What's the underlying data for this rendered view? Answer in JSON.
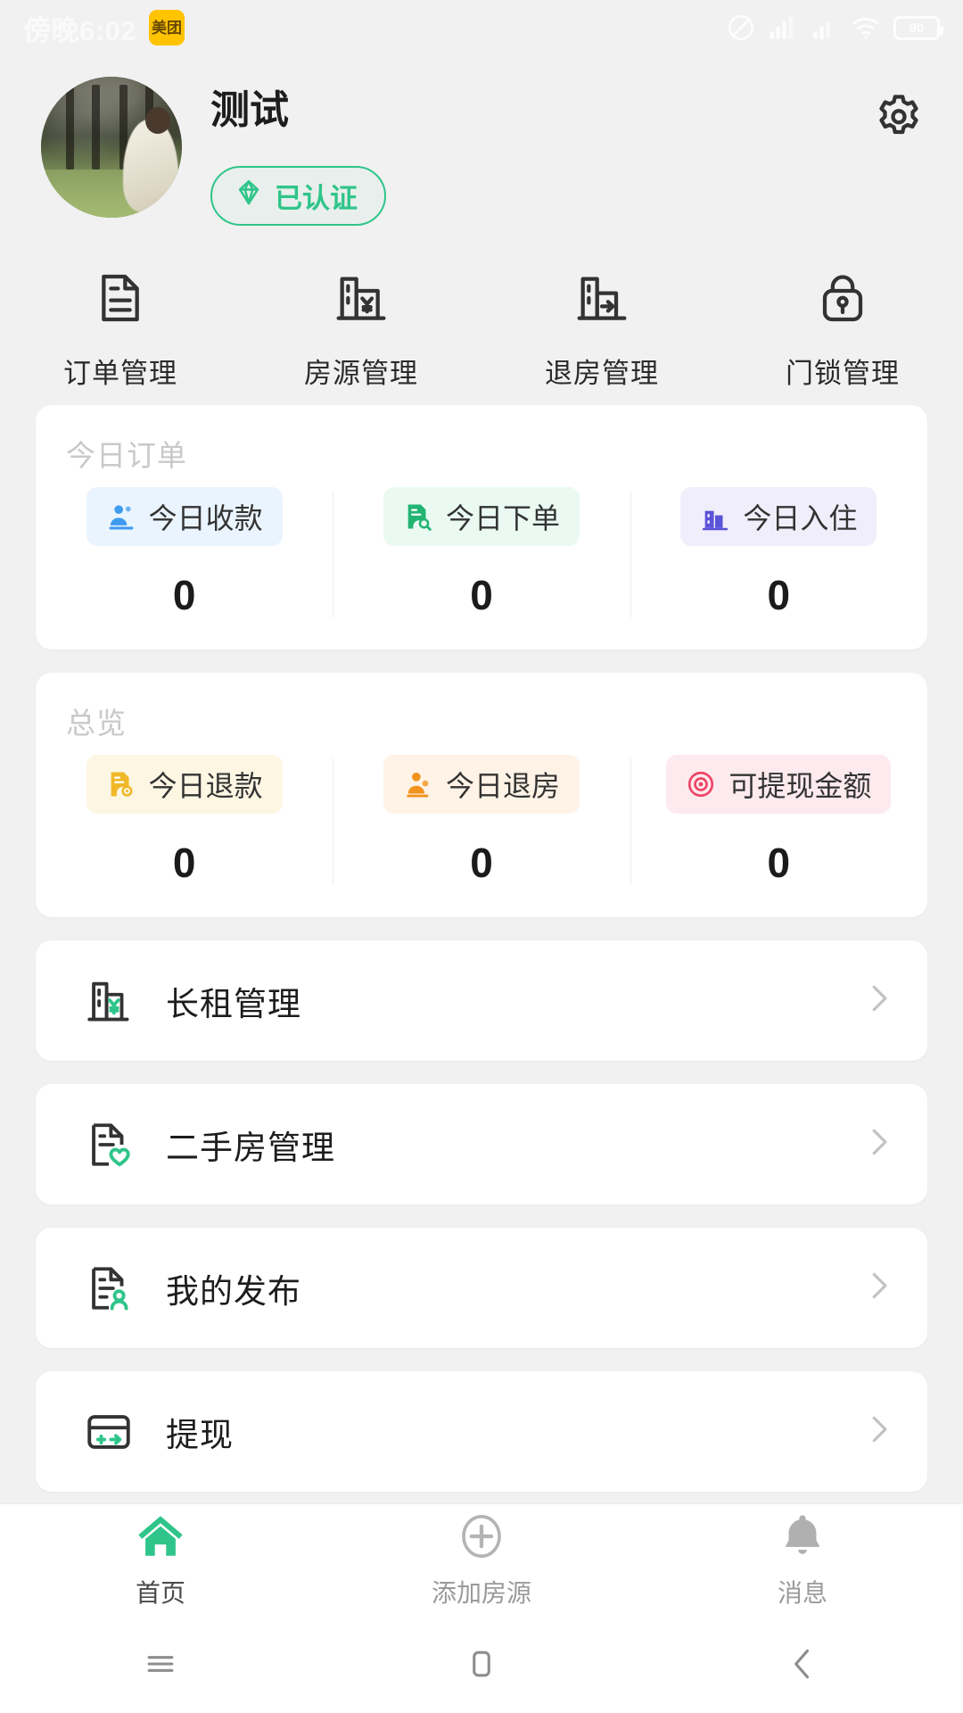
{
  "statusbar": {
    "time": "傍晚6:02",
    "app_badge": "美团",
    "battery_level": "90",
    "icons": [
      "mute-icon",
      "signal-icon",
      "signal-2-icon",
      "wifi-icon",
      "battery-icon"
    ]
  },
  "profile": {
    "name": "测试",
    "verified_label": "已认证",
    "verified_color": "#2FC58A",
    "settings_icon": "gear-icon",
    "avatar_alt": "user-avatar"
  },
  "quicknav": [
    {
      "label": "订单管理",
      "icon": "document-order-icon"
    },
    {
      "label": "房源管理",
      "icon": "building-yuan-icon"
    },
    {
      "label": "退房管理",
      "icon": "building-exit-icon"
    },
    {
      "label": "门锁管理",
      "icon": "lock-icon"
    }
  ],
  "today_card": {
    "title": "今日订单",
    "stats": [
      {
        "label": "今日收款",
        "value": "0",
        "icon": "user-payment-icon",
        "color": "#3E9BEF",
        "bg": "#EAF4FE"
      },
      {
        "label": "今日下单",
        "value": "0",
        "icon": "order-search-icon",
        "color": "#22B473",
        "bg": "#EAFAF2"
      },
      {
        "label": "今日入住",
        "value": "0",
        "icon": "checkin-building-icon",
        "color": "#5B53D8",
        "bg": "#F0EEFB"
      }
    ]
  },
  "overview_card": {
    "title": "总览",
    "stats": [
      {
        "label": "今日退款",
        "value": "0",
        "icon": "refund-icon",
        "color": "#F0B828",
        "bg": "#FDF6E3"
      },
      {
        "label": "今日退房",
        "value": "0",
        "icon": "checkout-user-icon",
        "color": "#F2931E",
        "bg": "#FEF3E6"
      },
      {
        "label": "可提现金额",
        "value": "0",
        "icon": "withdraw-target-icon",
        "color": "#EF4466",
        "bg": "#FDEAEE"
      }
    ]
  },
  "menu": [
    {
      "label": "长租管理",
      "icon": "longterm-building-icon",
      "chevron": "chevron-right-icon"
    },
    {
      "label": "二手房管理",
      "icon": "secondhand-house-icon",
      "chevron": "chevron-right-icon"
    },
    {
      "label": "我的发布",
      "icon": "my-posts-icon",
      "chevron": "chevron-right-icon"
    },
    {
      "label": "提现",
      "icon": "withdraw-card-icon",
      "chevron": "chevron-right-icon"
    }
  ],
  "tabbar": [
    {
      "label": "首页",
      "icon": "home-icon",
      "active": true
    },
    {
      "label": "添加房源",
      "icon": "plus-circle-icon",
      "active": false
    },
    {
      "label": "消息",
      "icon": "bell-icon",
      "active": false
    }
  ],
  "androidnav": [
    {
      "icon": "recents-icon"
    },
    {
      "icon": "home-square-icon"
    },
    {
      "icon": "back-icon"
    }
  ]
}
